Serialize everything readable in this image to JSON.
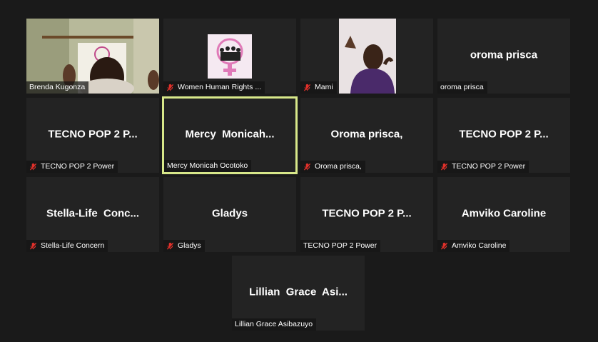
{
  "participants": [
    {
      "name": "Brenda Kugonza",
      "muted": false,
      "video": true
    },
    {
      "name": "Women Human Rights ...",
      "muted": true,
      "video": true
    },
    {
      "name": "Mami",
      "muted": true,
      "video": true
    },
    {
      "display": "oroma prisca",
      "name": "oroma prisca",
      "muted": false
    },
    {
      "display": "TECNO POP 2 P...",
      "name": "TECNO POP 2 Power",
      "muted": true
    },
    {
      "display": "Mercy  Monicah...",
      "name": "Mercy Monicah Ocotoko",
      "muted": false,
      "active": true
    },
    {
      "display": "Oroma prisca,",
      "name": "Oroma prisca,",
      "muted": true
    },
    {
      "display": "TECNO POP 2 P...",
      "name": "TECNO POP 2 Power",
      "muted": true
    },
    {
      "display": "Stella-Life  Conc...",
      "name": "Stella-Life Concern",
      "muted": true
    },
    {
      "display": "Gladys",
      "name": "Gladys",
      "muted": true
    },
    {
      "display": "TECNO POP 2 P...",
      "name": "TECNO POP 2 Power",
      "muted": false
    },
    {
      "display": "Amviko Caroline",
      "name": "Amviko Caroline",
      "muted": true
    },
    {
      "display": "Lillian  Grace  Asi...",
      "name": "Lillian Grace Asibazuyo",
      "muted": false
    }
  ],
  "colors": {
    "active_border": "#d8e88a",
    "muted_icon": "#e0302a",
    "tile_bg": "#232323"
  },
  "icons": {
    "muted": "mic-muted-icon"
  }
}
